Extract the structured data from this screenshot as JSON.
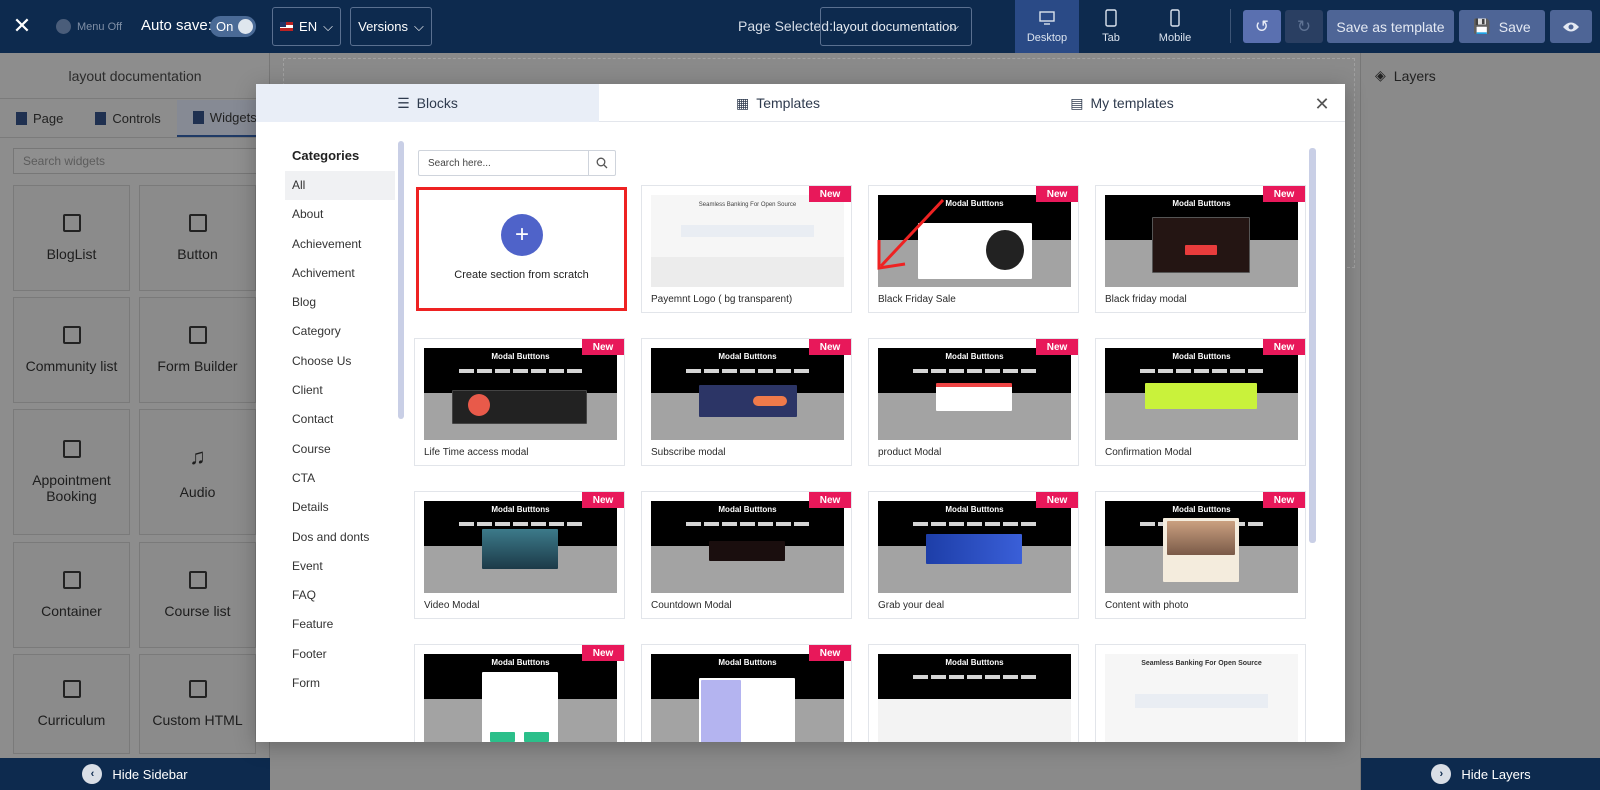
{
  "topbar": {
    "menu_off": "Menu Off",
    "auto_save_label": "Auto save:",
    "auto_save_state": "On",
    "language": "EN",
    "versions": "Versions",
    "page_selected_label": "Page Selected:",
    "page_selected_value": "layout documentation",
    "devices": [
      {
        "label": "Desktop",
        "active": true
      },
      {
        "label": "Tab",
        "active": false
      },
      {
        "label": "Mobile",
        "active": false
      }
    ],
    "save_as_template": "Save as template",
    "save": "Save"
  },
  "sidebar": {
    "title": "layout documentation",
    "tabs": [
      "Page",
      "Controls",
      "Widgets"
    ],
    "search_placeholder": "Search widgets",
    "widgets": [
      "BlogList",
      "Button",
      "Community list",
      "Form Builder",
      "Appointment Booking",
      "Audio",
      "Container",
      "Course list",
      "Curriculum",
      "Custom HTML"
    ],
    "hide_label": "Hide Sidebar"
  },
  "layers": {
    "title": "Layers",
    "hide_label": "Hide Layers"
  },
  "modal": {
    "tabs": [
      "Blocks",
      "Templates",
      "My templates"
    ],
    "categories_title": "Categories",
    "categories": [
      "All",
      "About",
      "Achievement",
      "Achivement",
      "Blog",
      "Category",
      "Choose Us",
      "Client",
      "Contact",
      "Course",
      "CTA",
      "Details",
      "Dos and donts",
      "Event",
      "FAQ",
      "Feature",
      "Footer",
      "Form"
    ],
    "search_placeholder": "Search here...",
    "create_label": "Create section from scratch",
    "badge": "New",
    "thumb_title": "Modal Butttons",
    "banking_title": "Seamless Banking For Open Source",
    "cards": [
      "Payemnt Logo ( bg transparent)",
      "Black Friday Sale",
      "Black friday modal",
      "Life Time access modal",
      "Subscribe modal",
      "product Modal",
      "Confirmation Modal",
      "Video Modal",
      "Countdown Modal",
      "Grab your deal",
      "Content with photo"
    ]
  }
}
